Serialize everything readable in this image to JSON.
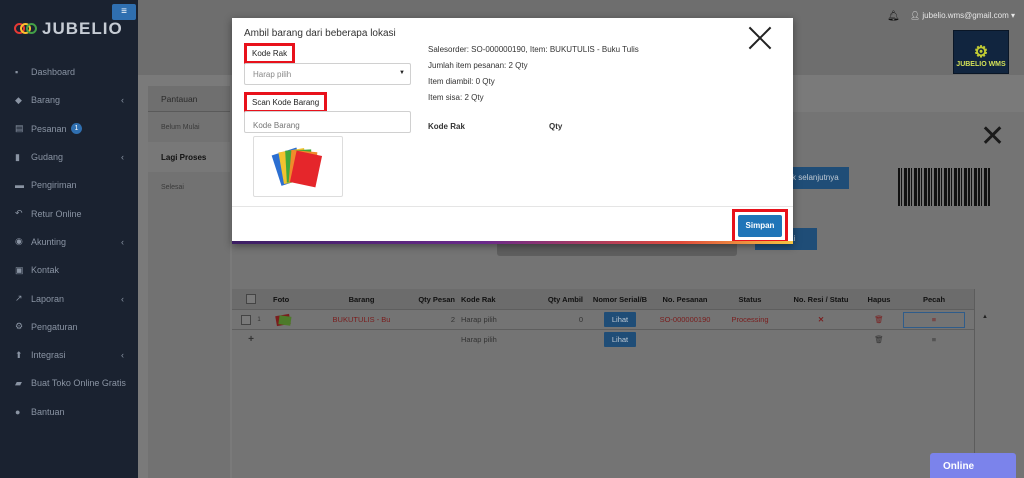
{
  "sidebar": {
    "brand": "JUBELIO",
    "menu_icon": "≡",
    "items": [
      {
        "icon": "dashboard-icon",
        "glyph": "▪",
        "label": "Dashboard",
        "chevron": false
      },
      {
        "icon": "barang-icon",
        "glyph": "◆",
        "label": "Barang",
        "chevron": true
      },
      {
        "icon": "pesanan-icon",
        "glyph": "▤",
        "label": "Pesanan",
        "chevron": false,
        "badge": "1"
      },
      {
        "icon": "gudang-icon",
        "glyph": "▮",
        "label": "Gudang",
        "chevron": true
      },
      {
        "icon": "truck-icon",
        "glyph": "▬",
        "label": "Pengiriman",
        "chevron": false
      },
      {
        "icon": "return-icon",
        "glyph": "↶",
        "label": "Retur Online",
        "chevron": false
      },
      {
        "icon": "akunting-icon",
        "glyph": "◉",
        "label": "Akunting",
        "chevron": true
      },
      {
        "icon": "contact-icon",
        "glyph": "▣",
        "label": "Kontak",
        "chevron": false
      },
      {
        "icon": "chart-icon",
        "glyph": "↗",
        "label": "Laporan",
        "chevron": true
      },
      {
        "icon": "settings-icon",
        "glyph": "⚙",
        "label": "Pengaturan",
        "chevron": false
      },
      {
        "icon": "integration-icon",
        "glyph": "⬆",
        "label": "Integrasi",
        "chevron": true
      },
      {
        "icon": "cart-icon",
        "glyph": "▰",
        "label": "Buat Toko Online Gratis",
        "chevron": false
      },
      {
        "icon": "help-icon",
        "glyph": "●",
        "label": "Bantuan",
        "chevron": false
      }
    ]
  },
  "header": {
    "user": "jubelio.wms@gmail.com",
    "wms_logo_text": "JUBELIO WMS"
  },
  "subtabs": {
    "pantauan": "Pantauan",
    "belum_mulai": "Belum Mulai",
    "lagi_proses": "Lagi Proses",
    "selesai": "Selesai"
  },
  "background_buttons": {
    "next": "k selanjutnya",
    "sai": "sai"
  },
  "table": {
    "headers": {
      "foto": "Foto",
      "barang": "Barang",
      "qty_pesan": "Qty Pesan",
      "kode_rak": "Kode Rak",
      "qty_ambil": "Qty Ambil",
      "nomor_serial": "Nomor Serial/B",
      "no_pesanan": "No. Pesanan",
      "status": "Status",
      "no_resi": "No. Resi / Statu",
      "hapus": "Hapus",
      "pecah": "Pecah"
    },
    "row1": {
      "index": "1",
      "barang": "BUKUTULIS - Bu",
      "qty_pesan": "2",
      "kode_rak": "Harap pilih",
      "qty_ambil": "0",
      "lihat": "Lihat",
      "no_pesanan": "SO-000000190",
      "status": "Processing"
    },
    "row2": {
      "add": "+",
      "kode_rak": "Harap pilih",
      "lihat": "Lihat"
    }
  },
  "online_chat": "Online",
  "modal": {
    "title": "Ambil barang dari beberapa lokasi",
    "kode_rak_label": "Kode Rak",
    "kode_rak_placeholder": "Harap pilih",
    "scan_label": "Scan Kode Barang",
    "scan_placeholder": "Kode Barang",
    "info": {
      "salesorder": "Salesorder: SO-000000190, Item: BUKUTULIS - Buku Tulis",
      "jumlah": "Jumlah item pesanan: 2 Qty",
      "diambil": "Item diambil: 0 Qty",
      "sisa": "Item sisa: 2 Qty"
    },
    "col_kode_rak": "Kode Rak",
    "col_qty": "Qty",
    "save_label": "Simpan"
  },
  "colors": {
    "highlight_border": "#e8111b",
    "primary_button": "#1f75b8",
    "sidebar_bg": "#1a2230",
    "status_red": "#7a1d1d"
  }
}
